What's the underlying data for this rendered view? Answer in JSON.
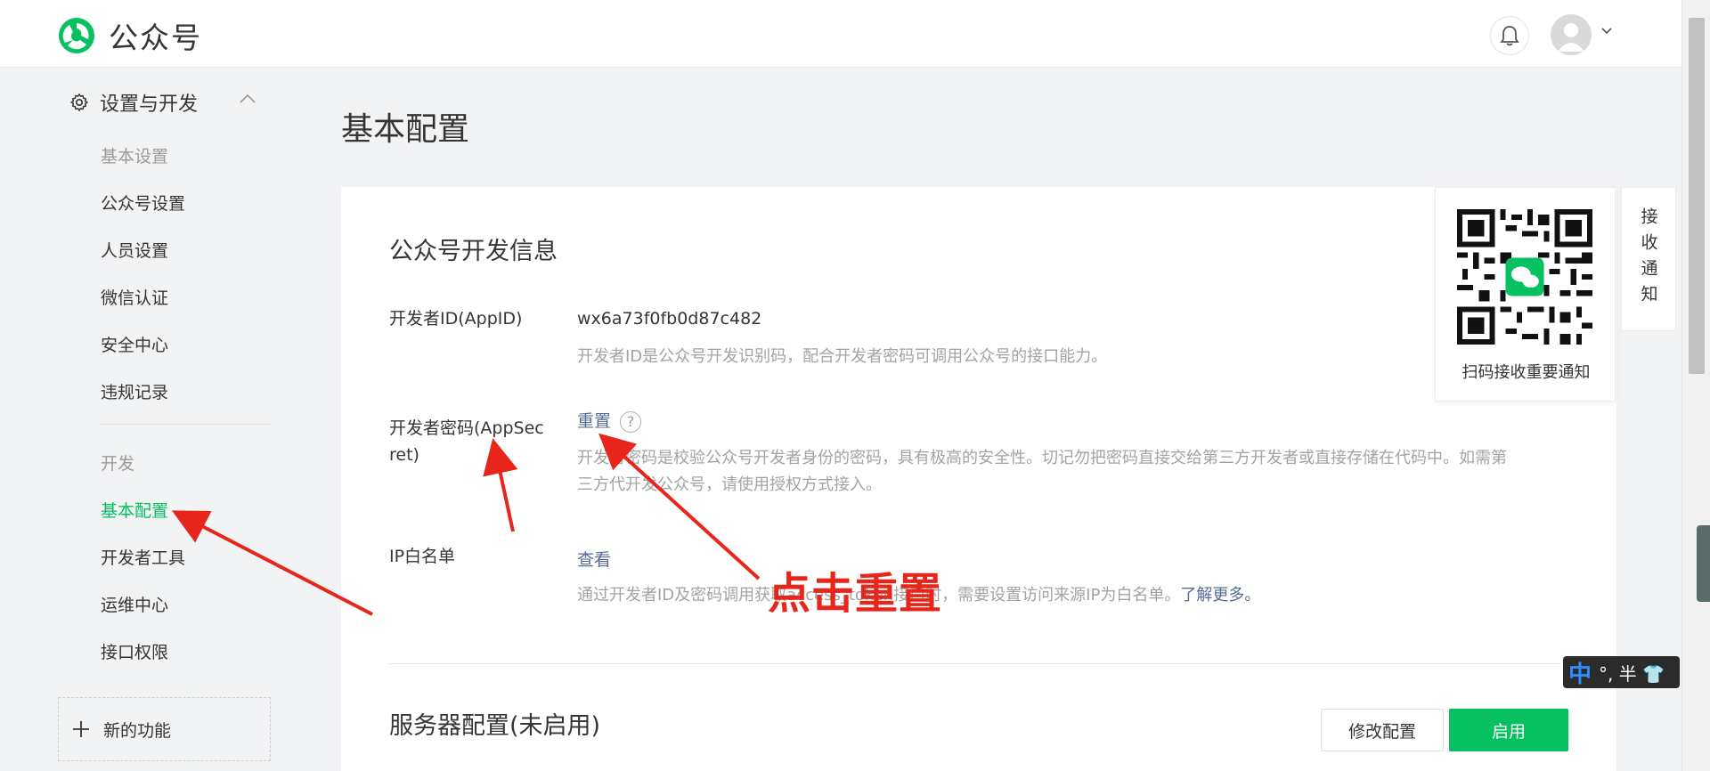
{
  "header": {
    "brand": "公众号",
    "bell_icon": "bell-icon",
    "avatar_icon": "user-avatar-icon",
    "caret_icon": "chevron-down-icon"
  },
  "sidebar": {
    "section_title": "设置与开发",
    "section_icon": "gear-icon",
    "group_settings": "基本设置",
    "settings_items": [
      "公众号设置",
      "人员设置",
      "微信认证",
      "安全中心",
      "违规记录"
    ],
    "group_dev": "开发",
    "dev_items": [
      "基本配置",
      "开发者工具",
      "运维中心",
      "接口权限"
    ],
    "active_item": "基本配置",
    "new_feature": "新的功能"
  },
  "main": {
    "page_title": "基本配置",
    "section_dev_info": "公众号开发信息",
    "appid_label": "开发者ID(AppID)",
    "appid_value": "wx6a73f0fb0d87c482",
    "appid_desc": "开发者ID是公众号开发识别码，配合开发者密码可调用公众号的接口能力。",
    "secret_label_1": "开发者密码(AppSec",
    "secret_label_2": "ret)",
    "secret_action": "重置",
    "secret_desc_1": "开发者密码是校验公众号开发者身份的密码，具有极高的安全性。切记勿把密码直接交给第三方开发者或直接存储在代码中。如需第",
    "secret_desc_2": "三方代开发公众号，请使用授权方式接入。",
    "ip_label": "IP白名单",
    "ip_action": "查看",
    "ip_desc": "通过开发者ID及密码调用获取access_token接口时，需要设置访问来源IP为白名单。",
    "ip_desc_link": "了解更多。",
    "section_server": "服务器配置(未启用)",
    "btn_modify": "修改配置",
    "btn_enable": "启用"
  },
  "qr_panel": {
    "caption": "扫码接收重要通知",
    "tab_label": "接收通知"
  },
  "annotation": {
    "text": "点击重置"
  },
  "ime": {
    "mode": "中",
    "rest": "°, 半 👕"
  },
  "colors": {
    "accent": "#07c160",
    "link": "#576b95",
    "annotation": "#e8251b"
  }
}
